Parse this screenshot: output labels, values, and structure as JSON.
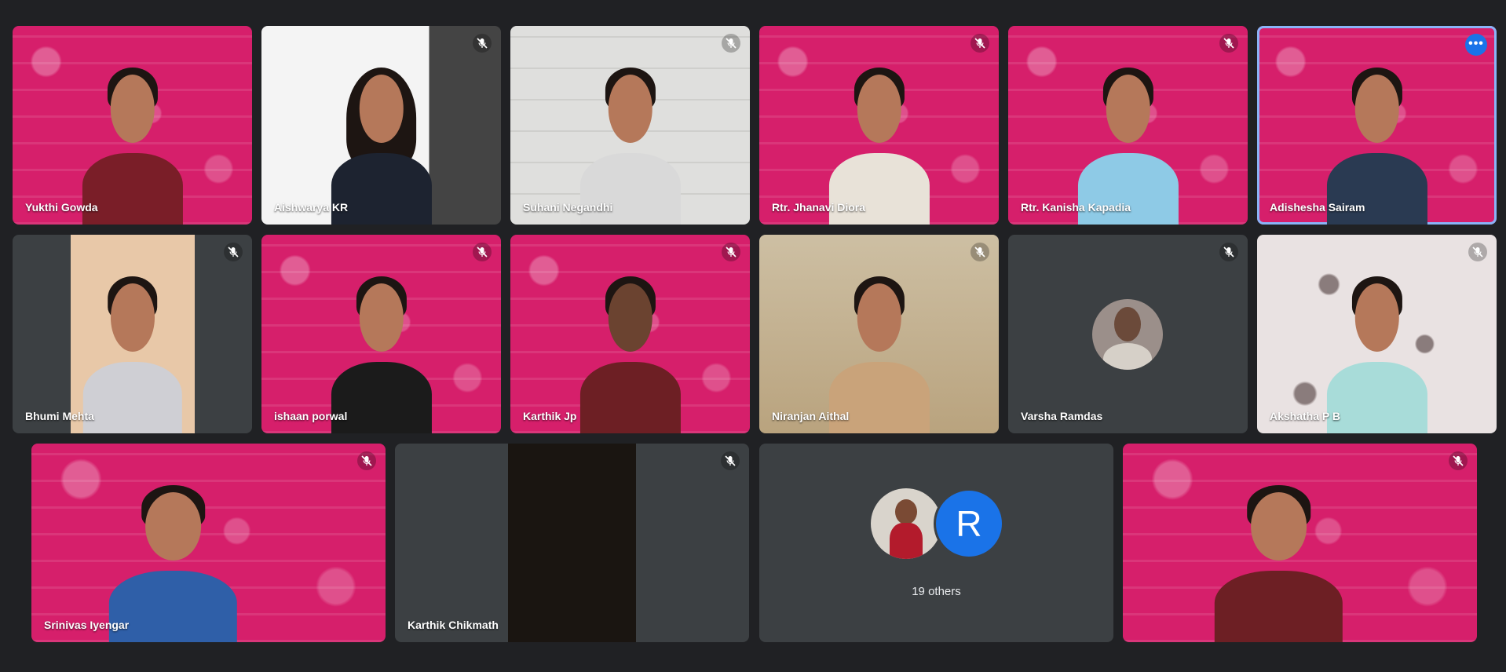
{
  "participants": {
    "yukthi": "Yukthi Gowda",
    "aishwarya": "Aishwarya KR",
    "suhani": "Suhani Negandhi",
    "jhanavi": "Rtr. Jhanavi Diora",
    "kanisha": "Rtr. Kanisha Kapadia",
    "adishesha": "Adishesha Sairam",
    "bhumi": "Bhumi Mehta",
    "ishaan": "ishaan porwal",
    "karthikjp": "Karthik Jp",
    "niranjan": "Niranjan Aithal",
    "varsha": "Varsha Ramdas",
    "akshatha": "Akshatha P B",
    "srinivas": "Srinivas Iyengar",
    "karthikc": "Karthik Chikmath"
  },
  "others": {
    "label": "19 others",
    "avatar_letter": "R",
    "avatar_color": "#1a73e8"
  },
  "icons": {
    "muted": "mic-off-icon",
    "more": "more-options-icon"
  },
  "colors": {
    "background": "#202124",
    "tile": "#3c4043",
    "brand_pink": "#d61f6b",
    "speaking_outline": "#8ab4f8"
  }
}
